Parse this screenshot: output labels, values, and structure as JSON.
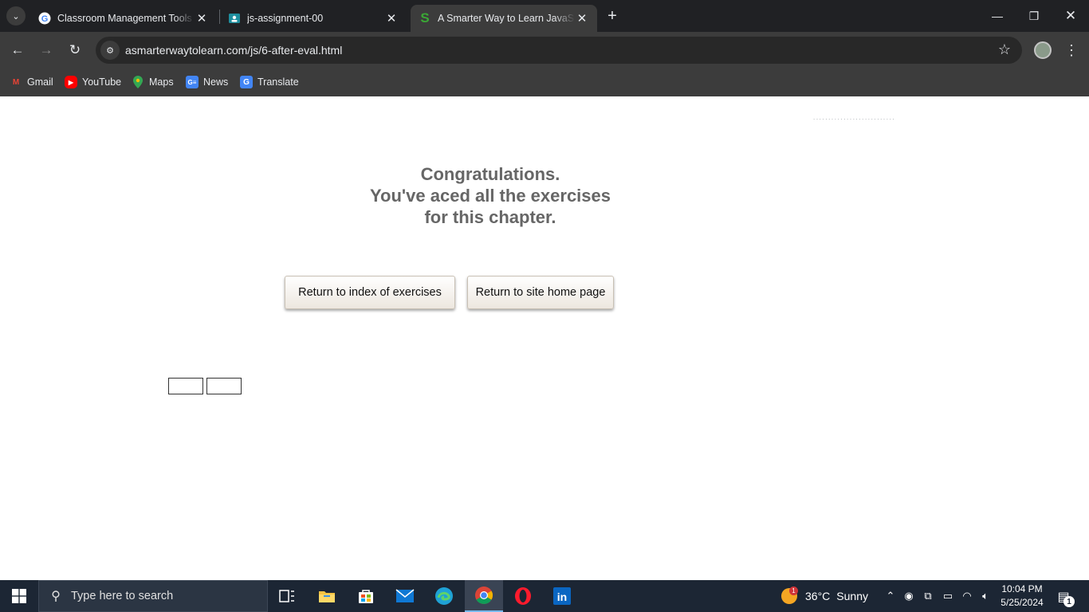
{
  "browser": {
    "tabs": [
      {
        "title": "Classroom Management Tools &",
        "favicon": "google-icon",
        "active": false
      },
      {
        "title": "js-assignment-00",
        "favicon": "classroom-icon",
        "active": false
      },
      {
        "title": "A Smarter Way to Learn JavaScript",
        "favicon": "smarter-way-icon",
        "active": true
      }
    ],
    "url": "asmarterwaytolearn.com/js/6-after-eval.html",
    "bookmarks": [
      {
        "label": "Gmail",
        "icon": "gmail-icon"
      },
      {
        "label": "YouTube",
        "icon": "youtube-icon"
      },
      {
        "label": "Maps",
        "icon": "maps-icon"
      },
      {
        "label": "News",
        "icon": "news-icon"
      },
      {
        "label": "Translate",
        "icon": "translate-icon"
      }
    ]
  },
  "page": {
    "message_lines": [
      "Congratulations.",
      "You've aced all the exercises",
      "for this chapter."
    ],
    "buttons": {
      "index": "Return to index of exercises",
      "home": "Return to site home page"
    }
  },
  "taskbar": {
    "search_placeholder": "Type here to search",
    "weather": {
      "temp": "36°C",
      "condition": "Sunny",
      "badge": "1"
    },
    "clock": {
      "time": "10:04 PM",
      "date": "5/25/2024"
    },
    "notification_count": "1"
  },
  "colors": {
    "message_text": "#666666",
    "tabbar_bg": "#202124",
    "toolbar_bg": "#3c3c3c",
    "taskbar_bg": "#1c2634"
  }
}
